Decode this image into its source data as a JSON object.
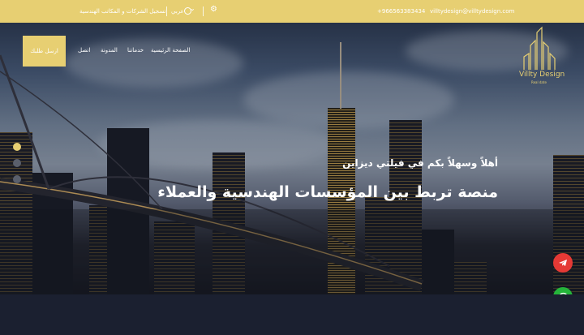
{
  "topbar": {
    "register_link": "تسجيل الشركات و المكاتب الهندسية",
    "language": "عربي",
    "phone": "+966563383434",
    "email": "villtydesign@villtydesign.com"
  },
  "nav": {
    "home": "الصفحة الرئيسية",
    "services": "خدماتنا",
    "blog": "المدونة",
    "contact": "اتصل",
    "cta": "ارسل طلبك"
  },
  "logo": {
    "name": "Villty Design",
    "tagline": "Real date"
  },
  "hero": {
    "welcome": "أهلاً وسهلاً بكم في فيلتي ديزاين",
    "headline": "منصة تربط بين المؤسسات الهندسية والعملاء"
  },
  "colors": {
    "accent": "#e7cf72",
    "telegram": "#e53935",
    "whatsapp": "#25b43a"
  },
  "icons": [
    "gear-icon",
    "globe-icon",
    "chevron-down-icon",
    "telegram-icon",
    "whatsapp-icon"
  ]
}
